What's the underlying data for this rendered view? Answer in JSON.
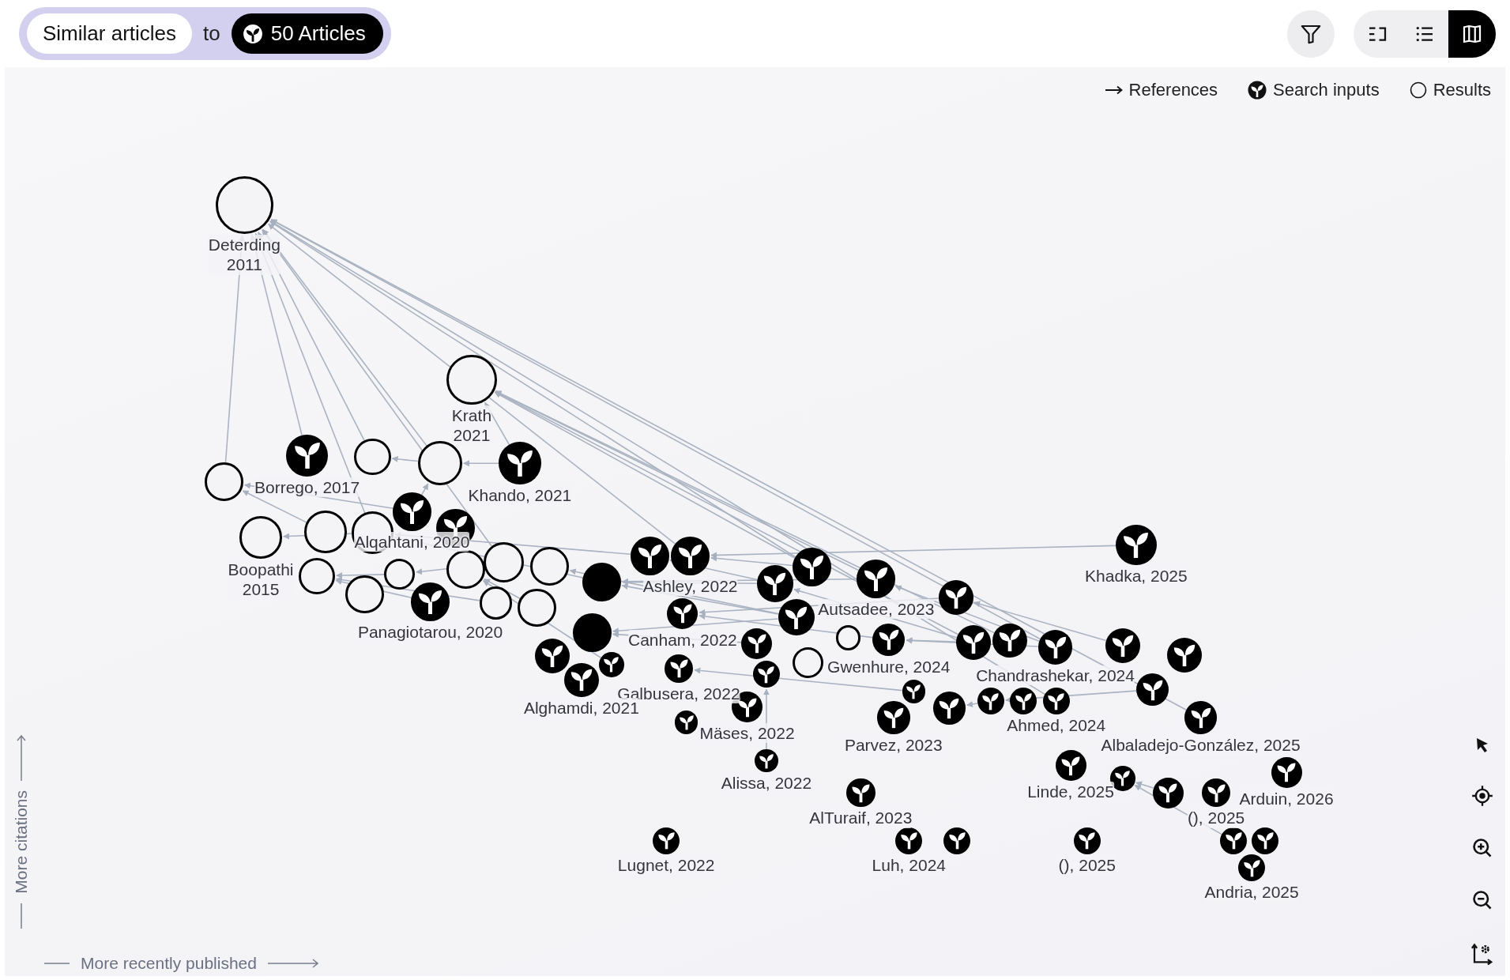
{
  "header": {
    "mode_button": "Similar articles",
    "connector": "to",
    "source_button": "50 Articles"
  },
  "view_buttons": [
    {
      "kind": "columns",
      "selected": false
    },
    {
      "kind": "list",
      "selected": false
    },
    {
      "kind": "map",
      "selected": true
    }
  ],
  "legend": [
    {
      "kind": "arrow",
      "label": "References"
    },
    {
      "kind": "input",
      "label": "Search inputs"
    },
    {
      "kind": "result",
      "label": "Results"
    }
  ],
  "axes": {
    "y_label": "More citations",
    "x_label": "More recently published"
  },
  "nodes": [
    {
      "kind": "result",
      "label": "Deterding 2011"
    },
    {
      "kind": "result",
      "label": "Krath 2021"
    },
    {
      "kind": "result"
    },
    {
      "kind": "result"
    },
    {
      "kind": "result"
    },
    {
      "kind": "input",
      "label": "Borrego, 2017"
    },
    {
      "kind": "input",
      "label": "Khando, 2021"
    },
    {
      "kind": "result",
      "label": "Boopathi 2015"
    },
    {
      "kind": "result"
    },
    {
      "kind": "result"
    },
    {
      "kind": "input",
      "label": "Alqahtani, 2020"
    },
    {
      "kind": "input"
    },
    {
      "kind": "result"
    },
    {
      "kind": "result"
    },
    {
      "kind": "result"
    },
    {
      "kind": "result"
    },
    {
      "kind": "result"
    },
    {
      "kind": "result"
    },
    {
      "kind": "input",
      "label": "Panagiotarou, 2020"
    },
    {
      "kind": "result"
    },
    {
      "kind": "result"
    },
    {
      "kind": "filled"
    },
    {
      "kind": "filled"
    },
    {
      "kind": "input"
    },
    {
      "kind": "input",
      "label": "Ashley, 2022"
    },
    {
      "kind": "input",
      "label": "Canham, 2022"
    },
    {
      "kind": "input"
    },
    {
      "kind": "input",
      "label": "Galbusera, 2022"
    },
    {
      "kind": "input"
    },
    {
      "kind": "input"
    },
    {
      "kind": "input",
      "label": "Alghamdi, 2021"
    },
    {
      "kind": "input"
    },
    {
      "kind": "input",
      "label": "Mäses, 2022"
    },
    {
      "kind": "input"
    },
    {
      "kind": "input",
      "label": "Alissa, 2022"
    },
    {
      "kind": "input"
    },
    {
      "kind": "input"
    },
    {
      "kind": "input"
    },
    {
      "kind": "result"
    },
    {
      "kind": "input",
      "label": "Autsadee, 2023"
    },
    {
      "kind": "input"
    },
    {
      "kind": "input",
      "label": "Gwenhure, 2024"
    },
    {
      "kind": "result"
    },
    {
      "kind": "input"
    },
    {
      "kind": "input"
    },
    {
      "kind": "input"
    },
    {
      "kind": "input"
    },
    {
      "kind": "input",
      "label": "Chandrashekar, 2024"
    },
    {
      "kind": "input"
    },
    {
      "kind": "input"
    },
    {
      "kind": "input"
    },
    {
      "kind": "input"
    },
    {
      "kind": "input",
      "label": "Ahmed, 2024"
    },
    {
      "kind": "input"
    },
    {
      "kind": "input",
      "label": "Albaladejo-González, 2025"
    },
    {
      "kind": "input"
    },
    {
      "kind": "input",
      "label": "Linde, 2025"
    },
    {
      "kind": "input"
    },
    {
      "kind": "input",
      "label": "(), 2025"
    },
    {
      "kind": "input",
      "label": "Arduin, 2026"
    },
    {
      "kind": "input"
    },
    {
      "kind": "input"
    },
    {
      "kind": "input",
      "label": "Andria, 2025"
    },
    {
      "kind": "input",
      "label": "Khadka, 2025"
    },
    {
      "kind": "input",
      "label": "Parvez, 2023"
    },
    {
      "kind": "input",
      "label": "AlTuraif, 2023"
    },
    {
      "kind": "input",
      "label": "Lugnet, 2022"
    },
    {
      "kind": "input",
      "label": "Luh, 2024"
    },
    {
      "kind": "input"
    },
    {
      "kind": "input",
      "label": "(), 2025"
    }
  ]
}
